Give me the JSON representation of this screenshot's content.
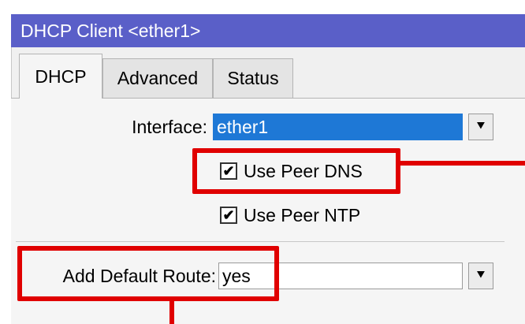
{
  "window": {
    "title": "DHCP Client <ether1>"
  },
  "tabs": [
    {
      "label": "DHCP",
      "active": true
    },
    {
      "label": "Advanced",
      "active": false
    },
    {
      "label": "Status",
      "active": false
    }
  ],
  "form": {
    "interface": {
      "label": "Interface:",
      "value": "ether1"
    },
    "use_peer_dns": {
      "label": "Use Peer DNS",
      "checked": true
    },
    "use_peer_ntp": {
      "label": "Use Peer NTP",
      "checked": true
    },
    "add_default_route": {
      "label": "Add Default Route:",
      "value": "yes"
    }
  },
  "icons": {
    "check": "✔",
    "dropdown": "⯆"
  },
  "colors": {
    "titlebar": "#5a5fc8",
    "selection": "#1e78d6",
    "highlight_annotation": "#e00000"
  }
}
